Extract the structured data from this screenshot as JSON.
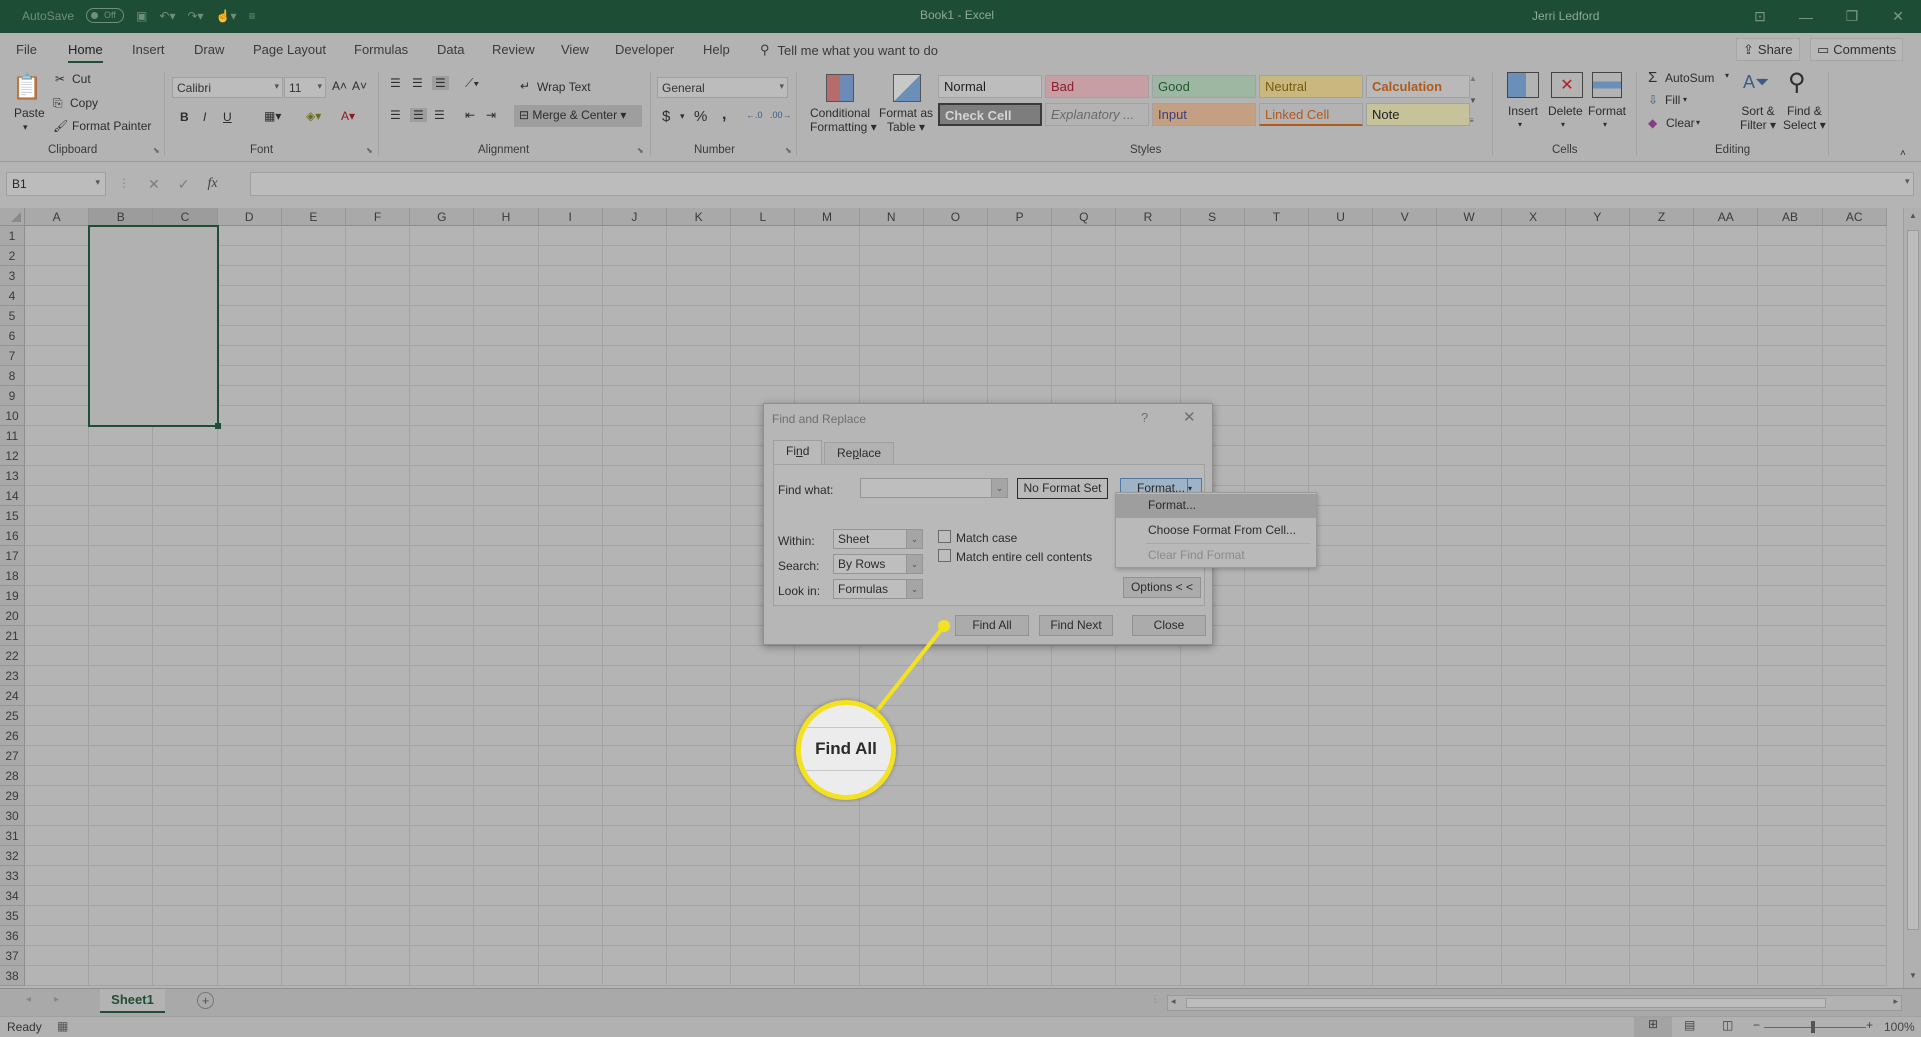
{
  "titlebar": {
    "autosave_label": "AutoSave",
    "autosave_state": "Off",
    "title": "Book1  -  Excel",
    "user": "Jerri Ledford",
    "icons": [
      "save-icon",
      "undo-icon",
      "redo-icon",
      "touch-mode-icon",
      "customize-qat-icon"
    ]
  },
  "menu": {
    "tabs": [
      "File",
      "Home",
      "Insert",
      "Draw",
      "Page Layout",
      "Formulas",
      "Data",
      "Review",
      "View",
      "Developer",
      "Help"
    ],
    "active": "Home",
    "tell_me": "Tell me what you want to do",
    "share": "Share",
    "comments": "Comments"
  },
  "ribbon": {
    "clipboard": {
      "label": "Clipboard",
      "paste": "Paste",
      "cut": "Cut",
      "copy": "Copy",
      "format_painter": "Format Painter"
    },
    "font": {
      "label": "Font",
      "font_name": "Calibri",
      "font_size": "11",
      "bold": "B",
      "italic": "I",
      "underline": "U"
    },
    "alignment": {
      "label": "Alignment",
      "wrap_text": "Wrap Text",
      "merge_center": "Merge & Center"
    },
    "number": {
      "label": "Number",
      "format": "General",
      "currency": "$",
      "percent": "%",
      "comma": ","
    },
    "styles": {
      "label": "Styles",
      "conditional_formatting": [
        "Conditional",
        "Formatting"
      ],
      "format_as_table": [
        "Format as",
        "Table"
      ],
      "cells": [
        {
          "name": "Normal",
          "bg": "#bdbdbd",
          "fg": "#1f1f1f"
        },
        {
          "name": "Bad",
          "bg": "#c79ea4",
          "fg": "#8a1e2d"
        },
        {
          "name": "Good",
          "bg": "#9eb7a2",
          "fg": "#1f5a2a"
        },
        {
          "name": "Neutral",
          "bg": "#c8b77f",
          "fg": "#7a5b0c"
        },
        {
          "name": "Calculation",
          "bg": "#b9b9b9",
          "fg": "#b05a1e"
        },
        {
          "name": "Check Cell",
          "bg": "#7d7d7d",
          "fg": "#d4d4d4"
        },
        {
          "name": "Explanatory ...",
          "bg": "#b3b3b3",
          "fg": "#6a6a6a"
        },
        {
          "name": "Input",
          "bg": "#c4a082",
          "fg": "#3e3e7c"
        },
        {
          "name": "Linked Cell",
          "bg": "#b3b3b3",
          "fg": "#b05a1e"
        },
        {
          "name": "Note",
          "bg": "#c6c39b",
          "fg": "#1f1f1f"
        }
      ]
    },
    "cells": {
      "label": "Cells",
      "insert": "Insert",
      "delete": "Delete",
      "format": "Format"
    },
    "editing": {
      "label": "Editing",
      "autosum": "AutoSum",
      "fill": "Fill",
      "clear": "Clear",
      "sort_filter": [
        "Sort &",
        "Filter"
      ],
      "find_select": [
        "Find &",
        "Select"
      ]
    }
  },
  "formula_bar": {
    "name_box": "B1",
    "fx": "fx",
    "value": ""
  },
  "grid": {
    "columns": [
      "A",
      "B",
      "C",
      "D",
      "E",
      "F",
      "G",
      "H",
      "I",
      "J",
      "K",
      "L",
      "M",
      "N",
      "O",
      "P",
      "Q",
      "R",
      "S",
      "T",
      "U",
      "V",
      "W",
      "X",
      "Y",
      "Z",
      "AA",
      "AB",
      "AC"
    ],
    "rows": [
      "1",
      "2",
      "3",
      "4",
      "5",
      "6",
      "7",
      "8",
      "9",
      "10",
      "11",
      "12",
      "13",
      "14",
      "15",
      "16",
      "17",
      "18",
      "19",
      "20",
      "21",
      "22",
      "23",
      "24",
      "25",
      "26",
      "27",
      "28",
      "29",
      "30",
      "31",
      "32",
      "33",
      "34",
      "35",
      "36",
      "37",
      "38"
    ],
    "selected_range": "B1:C10"
  },
  "sheets": {
    "tabs": [
      "Sheet1"
    ],
    "active": "Sheet1"
  },
  "status": {
    "ready": "Ready",
    "zoom": "100%",
    "zoom_level_percent": 100
  },
  "dialog": {
    "title": "Find and Replace",
    "help": "?",
    "tabs": [
      "Find",
      "Replace"
    ],
    "active_tab": "Find",
    "find_what_label": "Find what:",
    "find_what_value": "",
    "no_format_set": "No Format Set",
    "format_button": "Format...",
    "within_label": "Within:",
    "within_value": "Sheet",
    "search_label": "Search:",
    "search_value": "By Rows",
    "look_in_label": "Look in:",
    "look_in_value": "Formulas",
    "match_case": "Match case",
    "match_case_checked": false,
    "match_entire": "Match entire cell contents",
    "match_entire_checked": false,
    "options_button": "Options < <",
    "find_all": "Find All",
    "find_next": "Find Next",
    "close": "Close",
    "format_menu": [
      "Format...",
      "Choose Format From Cell...",
      "Clear Find Format"
    ]
  },
  "callout": {
    "text": "Find All",
    "color": "#f4e21e"
  }
}
